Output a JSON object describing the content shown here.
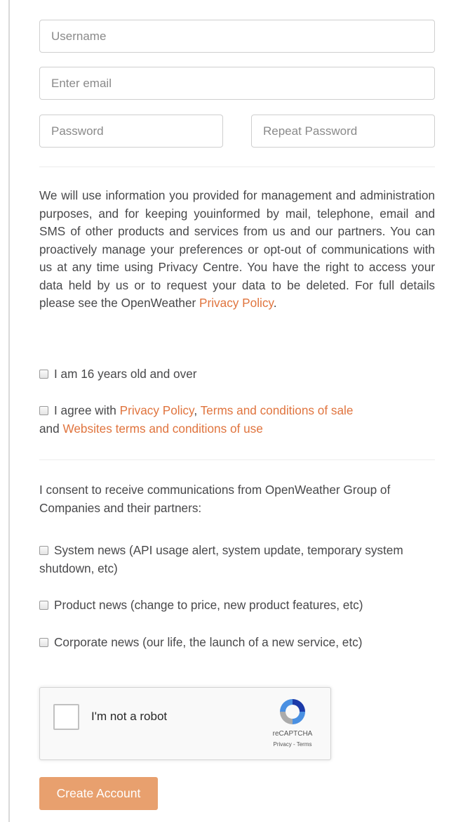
{
  "form": {
    "username_placeholder": "Username",
    "email_placeholder": "Enter email",
    "password_placeholder": "Password",
    "repeat_password_placeholder": "Repeat Password"
  },
  "privacy_notice": {
    "text": "We will use information you provided for management and administration purposes, and for keeping youinformed by mail, telephone, email and SMS of other products and services from us and our partners. You can proactively manage your preferences or opt-out of communications with us at any time using Privacy Centre. You have the right to access your data held by us or to request your data to be deleted. For full details please see the OpenWeather ",
    "link": "Privacy Policy",
    "end": "."
  },
  "agreements": {
    "age_label": "I am 16 years old and over",
    "agree_prefix": "I agree with ",
    "privacy_link": "Privacy Policy",
    "comma": ", ",
    "terms_sale_link": "Terms and conditions of sale",
    "and": " and ",
    "website_terms_link": "Websites terms and conditions of use"
  },
  "consent": {
    "intro": "I consent to receive communications from OpenWeather Group of Companies and their partners:",
    "options": [
      "System news (API usage alert, system update, temporary system shutdown, etc)",
      "Product news (change to price, new product features, etc)",
      "Corporate news (our life, the launch of a new service, etc)"
    ]
  },
  "recaptcha": {
    "label": "I'm not a robot",
    "brand": "reCAPTCHA",
    "terms": "Privacy - Terms"
  },
  "submit_label": "Create Account",
  "colors": {
    "link": "#e0743e",
    "button": "#e8a06e"
  }
}
